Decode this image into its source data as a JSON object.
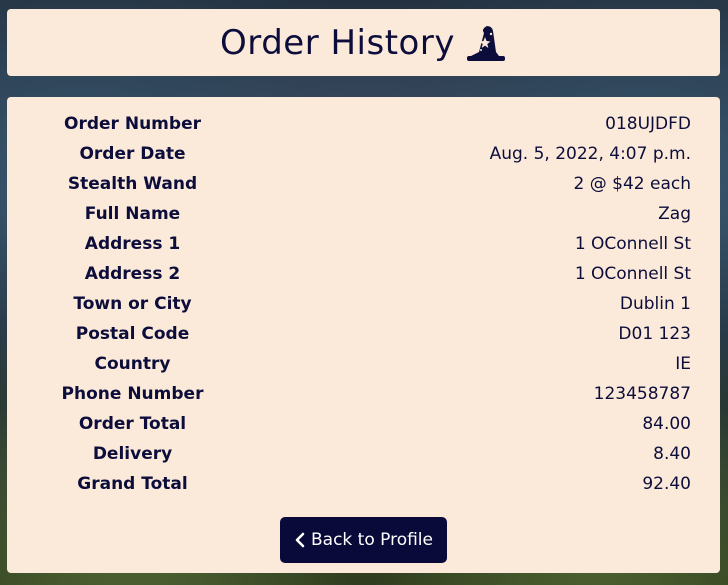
{
  "header": {
    "title": "Order History",
    "icon": "wizard-hat-icon"
  },
  "order_details": [
    {
      "label": "Order Number",
      "value": "018UJDFD"
    },
    {
      "label": "Order Date",
      "value": "Aug. 5, 2022, 4:07 p.m."
    },
    {
      "label": "Stealth Wand",
      "value": "2 @ $42 each"
    },
    {
      "label": "Full Name",
      "value": "Zag"
    },
    {
      "label": "Address 1",
      "value": "1 OConnell St"
    },
    {
      "label": "Address 2",
      "value": "1 OConnell St"
    },
    {
      "label": "Town or City",
      "value": "Dublin 1"
    },
    {
      "label": "Postal Code",
      "value": "D01 123"
    },
    {
      "label": "Country",
      "value": "IE"
    },
    {
      "label": "Phone Number",
      "value": "123458787"
    },
    {
      "label": "Order Total",
      "value": "84.00"
    },
    {
      "label": "Delivery",
      "value": "8.40"
    },
    {
      "label": "Grand Total",
      "value": "92.40"
    }
  ],
  "actions": {
    "back_label": "Back to Profile",
    "back_icon": "chevron-left-icon"
  },
  "colors": {
    "panel_background": "#fbeada",
    "text": "#0d0d3b",
    "button_background": "#0a0a3a",
    "button_text": "#ffffff"
  }
}
